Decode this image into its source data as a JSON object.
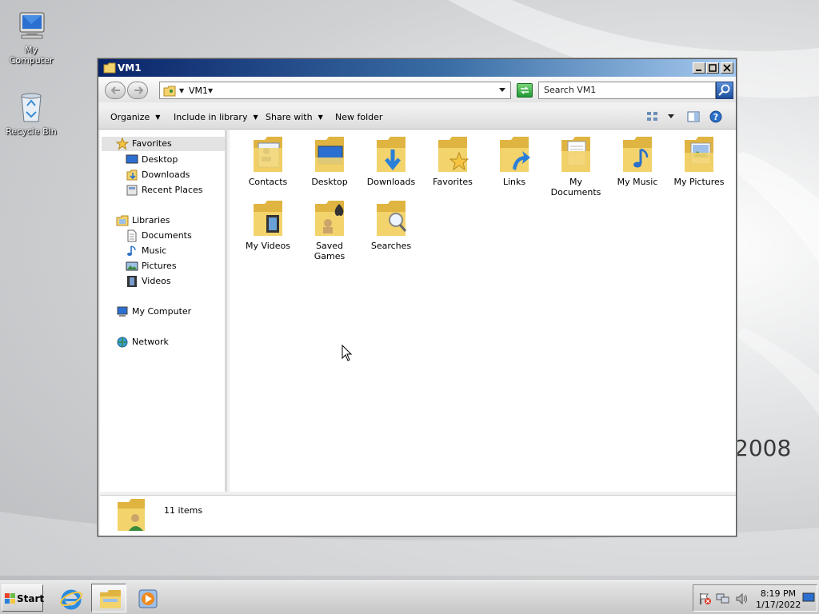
{
  "desktop": {
    "brand_partial": "2008",
    "icons": [
      {
        "label": "My Computer",
        "icon": "computer-icon"
      },
      {
        "label": "Recycle Bin",
        "icon": "recycle-bin-icon"
      }
    ]
  },
  "window": {
    "title": "VM1",
    "address": {
      "crumb": "VM1"
    },
    "search": {
      "placeholder": "Search VM1"
    },
    "commands": {
      "organize": "Organize",
      "include_in_library": "Include in library",
      "share_with": "Share with",
      "new_folder": "New folder"
    },
    "nav": {
      "favorites": "Favorites",
      "desktop": "Desktop",
      "downloads": "Downloads",
      "recent_places": "Recent Places",
      "libraries": "Libraries",
      "documents": "Documents",
      "music": "Music",
      "pictures": "Pictures",
      "videos": "Videos",
      "my_computer": "My Computer",
      "network": "Network"
    },
    "folders": [
      {
        "label": "Contacts",
        "icon": "contacts-folder-icon"
      },
      {
        "label": "Desktop",
        "icon": "desktop-folder-icon"
      },
      {
        "label": "Downloads",
        "icon": "downloads-folder-icon"
      },
      {
        "label": "Favorites",
        "icon": "favorites-folder-icon"
      },
      {
        "label": "Links",
        "icon": "links-folder-icon"
      },
      {
        "label": "My Documents",
        "icon": "documents-folder-icon"
      },
      {
        "label": "My Music",
        "icon": "music-folder-icon"
      },
      {
        "label": "My Pictures",
        "icon": "pictures-folder-icon"
      },
      {
        "label": "My Videos",
        "icon": "videos-folder-icon"
      },
      {
        "label": "Saved Games",
        "icon": "saved-games-folder-icon"
      },
      {
        "label": "Searches",
        "icon": "searches-folder-icon"
      }
    ],
    "details": {
      "item_count": "11 items"
    }
  },
  "taskbar": {
    "start_label": "Start",
    "clock": {
      "time": "8:19 PM",
      "date": "1/17/2022"
    }
  },
  "colors": {
    "title_gradient_start": "#0a246a",
    "folder_yellow": "#f3d36b",
    "accent_blue": "#2a6fc9"
  }
}
